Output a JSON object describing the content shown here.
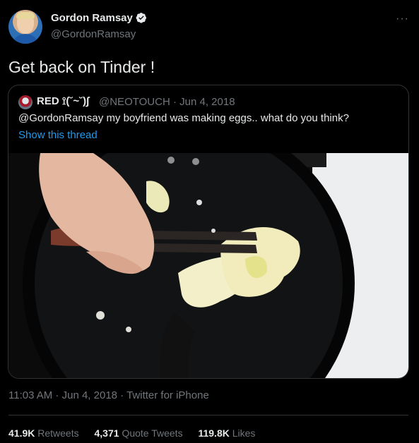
{
  "author": {
    "name": "Gordon Ramsay",
    "handle": "@GordonRamsay"
  },
  "tweet": {
    "text": "Get back on Tinder !"
  },
  "quote": {
    "name": "RED ⟟(˘~˘)∫",
    "handle": "@NEOTOUCH",
    "date": "· Jun 4, 2018",
    "text": "@GordonRamsay my boyfriend was making eggs.. what do you think?",
    "show_thread": "Show this thread"
  },
  "meta": {
    "time": "11:03 AM",
    "sep1": " · ",
    "date": "Jun 4, 2018",
    "sep2": " · ",
    "source": "Twitter for iPhone"
  },
  "stats": {
    "retweets_count": "41.9K",
    "retweets_label": "Retweets",
    "quotes_count": "4,371",
    "quotes_label": "Quote Tweets",
    "likes_count": "119.8K",
    "likes_label": "Likes"
  },
  "colors": {
    "background": "#000000",
    "text": "#e7e9ea",
    "secondary": "#71767b",
    "link": "#1d9bf0",
    "border": "#2f3336"
  }
}
